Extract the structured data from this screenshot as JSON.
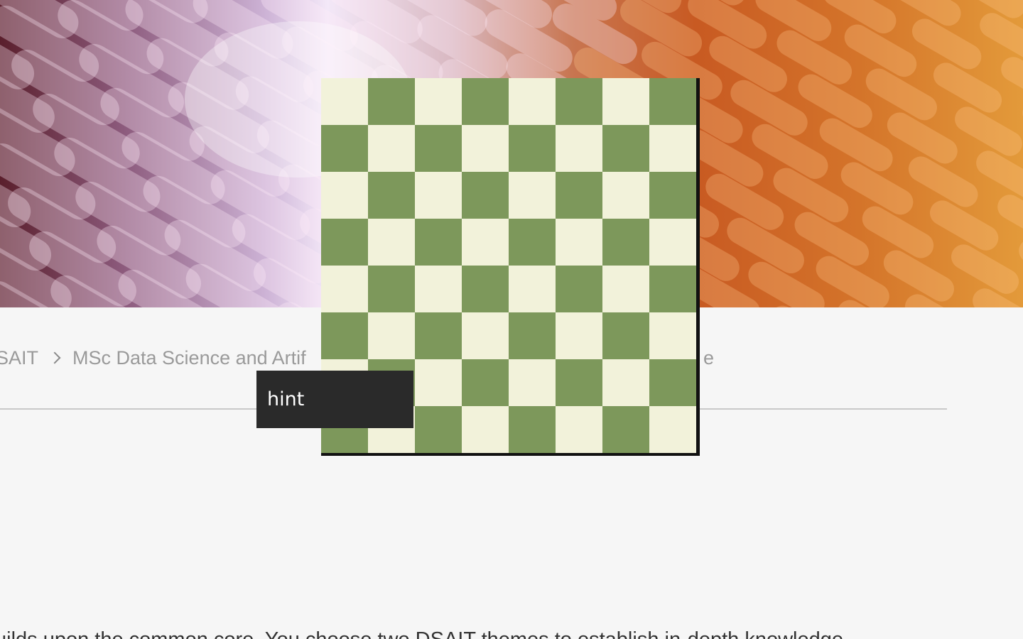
{
  "hero": {
    "image": "abstract-orange-purple-pill-pattern"
  },
  "breadcrumb": {
    "items": [
      {
        "label": "SAIT"
      },
      {
        "label": "MSc Data Science and Artif"
      }
    ],
    "tail": "e",
    "separator_icon": "chevron-right-icon"
  },
  "body": {
    "text": "uilds upon the common core. You choose two DSAIT themes to establish in-depth knowledge"
  },
  "chess_board": {
    "rows": 8,
    "cols": 8,
    "light_color": "#f2f2da",
    "dark_color": "#7d985b",
    "top_left": "light"
  },
  "hint_button": {
    "label": "hint"
  },
  "colors": {
    "page_background": "#f6f6f6",
    "breadcrumb_text": "#9a9a9a",
    "hint_background": "#2a2a2a"
  }
}
